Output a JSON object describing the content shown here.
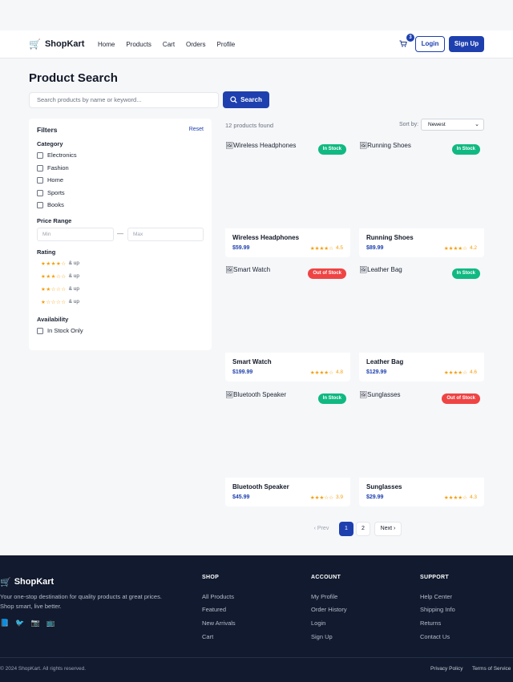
{
  "header": {
    "brand": "ShopKart",
    "nav": [
      "Home",
      "Products",
      "Cart",
      "Orders",
      "Profile"
    ],
    "cart_count": "3",
    "login": "Login",
    "signup": "Sign Up"
  },
  "page": {
    "title": "Product Search",
    "search_placeholder": "Search products by name or keyword...",
    "search_button": "Search"
  },
  "filters": {
    "title": "Filters",
    "reset": "Reset",
    "category_title": "Category",
    "categories": [
      "Electronics",
      "Fashion",
      "Home",
      "Sports",
      "Books"
    ],
    "price_title": "Price Range",
    "price_min_placeholder": "Min",
    "price_max_placeholder": "Max",
    "price_separator": "—",
    "rating_title": "Rating",
    "ratings": [
      {
        "stars": "★★★★☆",
        "label": "& up"
      },
      {
        "stars": "★★★☆☆",
        "label": "& up"
      },
      {
        "stars": "★★☆☆☆",
        "label": "& up"
      },
      {
        "stars": "★☆☆☆☆",
        "label": "& up"
      }
    ],
    "availability_title": "Availability",
    "in_stock_only": "In Stock Only"
  },
  "results": {
    "count": "12 products found",
    "sort_label": "Sort by:",
    "sort_value": "Newest"
  },
  "products": [
    {
      "name": "Wireless Headphones",
      "price": "$59.99",
      "stars": "★★★★☆",
      "rating": "4.5",
      "badge": "In Stock"
    },
    {
      "name": "Running Shoes",
      "price": "$89.99",
      "stars": "★★★★☆",
      "rating": "4.2",
      "badge": "In Stock"
    },
    {
      "name": "Smart Watch",
      "price": "$199.99",
      "stars": "★★★★☆",
      "rating": "4.8",
      "badge": "Out of Stock"
    },
    {
      "name": "Leather Bag",
      "price": "$129.99",
      "stars": "★★★★☆",
      "rating": "4.6",
      "badge": "In Stock"
    },
    {
      "name": "Bluetooth Speaker",
      "price": "$45.99",
      "stars": "★★★☆☆",
      "rating": "3.9",
      "badge": "In Stock"
    },
    {
      "name": "Sunglasses",
      "price": "$29.99",
      "stars": "★★★★☆",
      "rating": "4.3",
      "badge": "Out of Stock"
    }
  ],
  "pagination": {
    "prev": "‹ Prev",
    "pages": [
      "1",
      "2"
    ],
    "next": "Next ›"
  },
  "footer": {
    "brand": "ShopKart",
    "description": "Your one-stop destination for quality products at great prices. Shop smart, live better.",
    "columns": [
      {
        "title": "SHOP",
        "links": [
          "All Products",
          "Featured",
          "New Arrivals",
          "Cart"
        ]
      },
      {
        "title": "ACCOUNT",
        "links": [
          "My Profile",
          "Order History",
          "Login",
          "Sign Up"
        ]
      },
      {
        "title": "SUPPORT",
        "links": [
          "Help Center",
          "Shipping Info",
          "Returns",
          "Contact Us"
        ]
      }
    ],
    "copyright": "© 2024 ShopKart. All rights reserved.",
    "privacy": "Privacy Policy",
    "terms": "Terms of Service"
  },
  "colors": {
    "primary": "#1e40af",
    "in_stock": "#10b981",
    "out_of_stock": "#ef4444",
    "star": "#f59e0b",
    "footer_bg": "#111a2e"
  }
}
